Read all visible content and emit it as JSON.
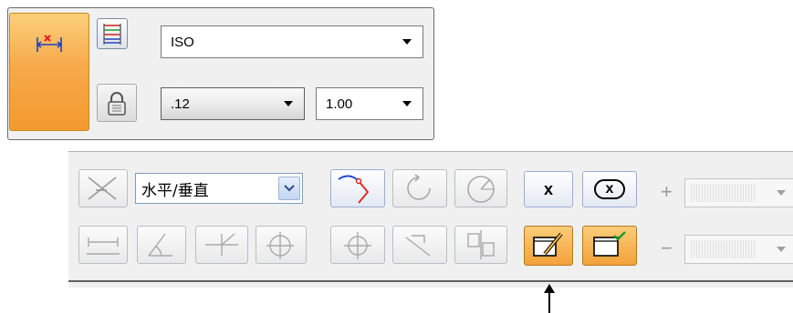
{
  "dimension_toolbar": {
    "style_select": {
      "value": "ISO"
    },
    "precision_select": {
      "value": ".12"
    },
    "scale_select": {
      "value": "1.00"
    }
  },
  "relationship_toolbar": {
    "direction_select": {
      "value": "水平/垂直"
    },
    "plus_label": "+",
    "minus_label": "−",
    "delete_button_label": "x",
    "delete_all_button_label": "x"
  },
  "colors": {
    "active_orange": "#f7a94b",
    "button_border_blue": "#9aaed0",
    "red_accent": "#e02020",
    "blue_accent": "#1a3fd0"
  },
  "icons": [
    "smart-dimension-icon",
    "dimension-style-icon",
    "lock-icon",
    "horizontal-vertical-icon",
    "distance-between-icon",
    "angle-between-icon",
    "coordinate-dimension-icon",
    "symmetric-diameter-icon",
    "connect-icon",
    "rotate-icon",
    "angular-rotate-icon",
    "center-point-icon",
    "move-dimension-icon",
    "align-icon",
    "delete-icon",
    "delete-all-icon",
    "edit-dimension-icon",
    "accept-dimension-icon",
    "pointer-arrow-icon"
  ]
}
